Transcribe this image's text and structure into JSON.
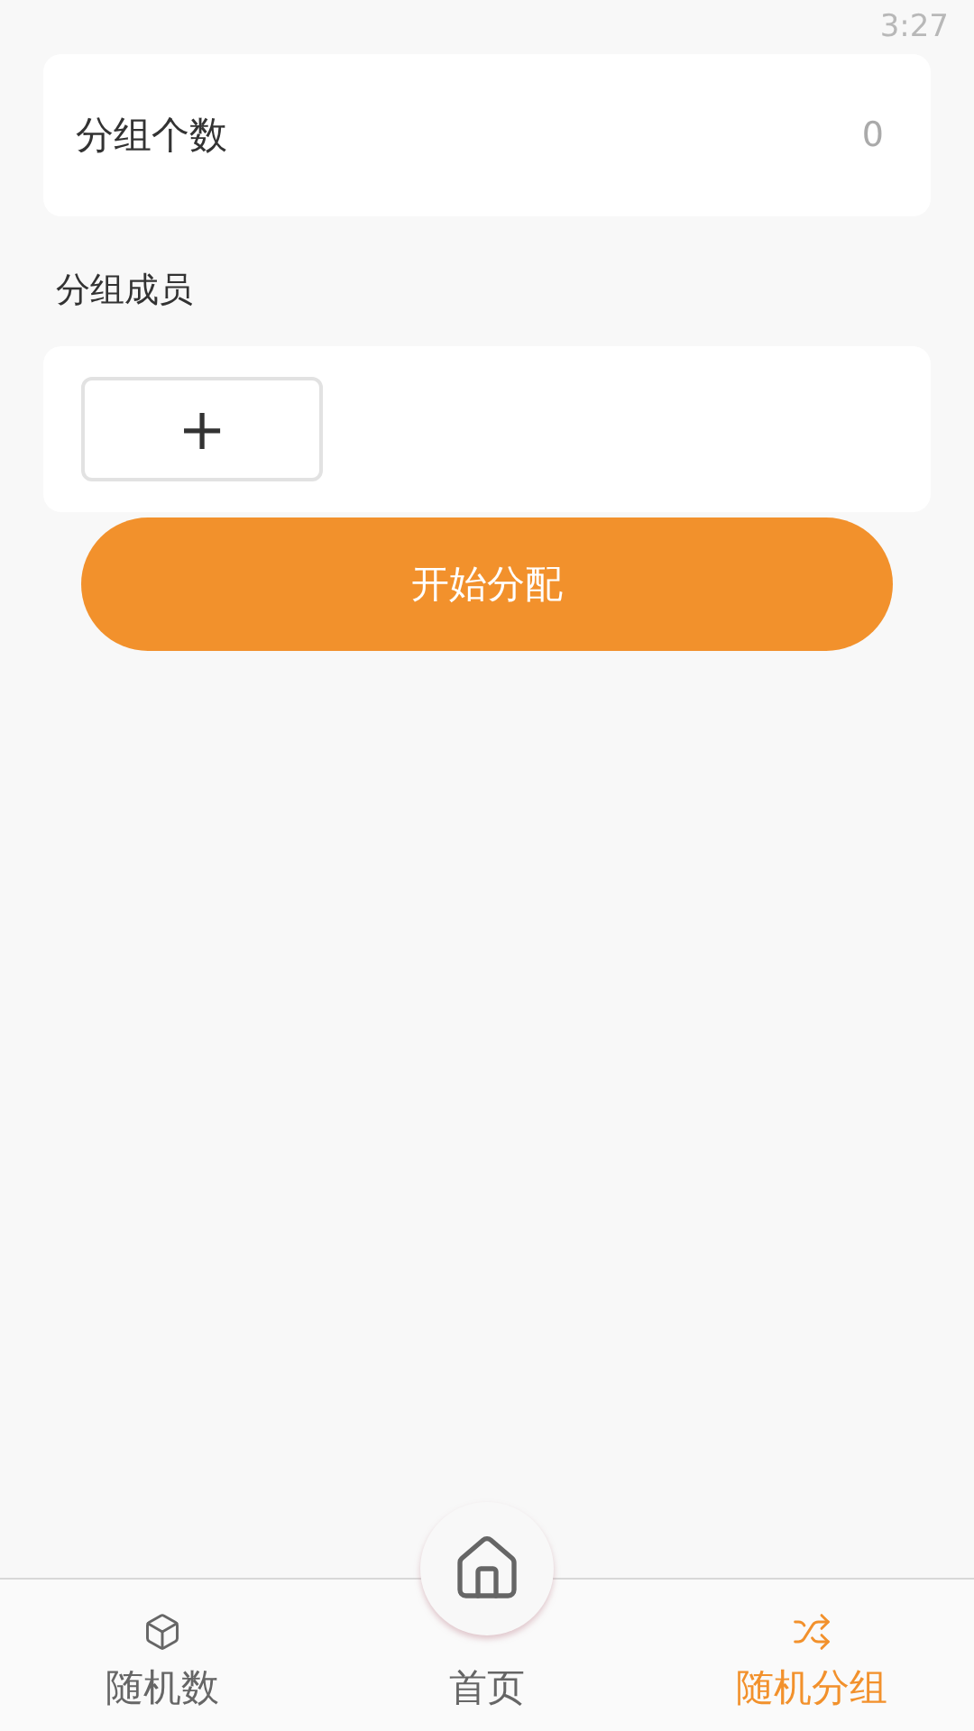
{
  "status_bar": {
    "time": "3:27"
  },
  "group_count": {
    "label": "分组个数",
    "value": "0"
  },
  "members": {
    "title": "分组成员",
    "add_button": "+"
  },
  "start_button": "开始分配",
  "nav": [
    {
      "label": "随机数",
      "kind": "dice",
      "selected": false
    },
    {
      "label": "首页",
      "kind": "home",
      "selected": false
    },
    {
      "label": "随机分组",
      "kind": "shuffle",
      "selected": true
    }
  ]
}
